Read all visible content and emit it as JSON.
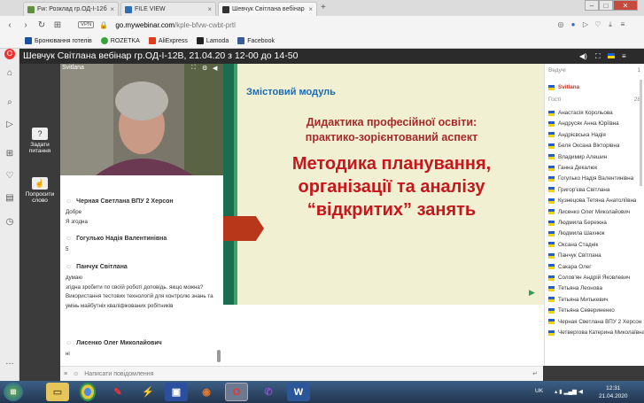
{
  "browser": {
    "tabs": [
      {
        "label": "Fw: Розклад гр.ОД-І-12б",
        "icon_color": "#5e8e3e"
      },
      {
        "label": "FILE VIEW",
        "icon_color": "#2e6db5"
      },
      {
        "label": "Шевчук Світлана вебінар",
        "icon_color": "#333333"
      }
    ],
    "new_tab": "+",
    "vpn": "VPN",
    "url_domain": "go.mywebinar.com",
    "url_path": "/kple-bfvw-cwbt-prtl",
    "bookmarks": [
      {
        "label": "Бронювання готелів",
        "color": "#1b4fa0"
      },
      {
        "label": "ROZETKA",
        "color": "#3aa33a"
      },
      {
        "label": "AliExpress",
        "color": "#e23c1e"
      },
      {
        "label": "Lamoda",
        "color": "#222222"
      },
      {
        "label": "Facebook",
        "color": "#3b5998"
      }
    ]
  },
  "webinar": {
    "title": "Шевчук Світлана вебінар гр.ОД-І-12В, 21.04.20 з 12-00 до 14-50",
    "left_buttons": [
      {
        "label": "Задати питання",
        "icon": "question-icon"
      },
      {
        "label": "Попросити слово",
        "icon": "raise-hand-icon"
      }
    ],
    "video": {
      "speaker": "Svitlana"
    },
    "chat": {
      "messages": [
        {
          "author": "Черная Светлана ВПУ 2 Херсон",
          "text": "Добре\nЯ згодна"
        },
        {
          "author": "Гогулько Надія Валентинівна",
          "text": "5"
        },
        {
          "author": "Панчук Світлана",
          "text": "думаю\nзгідна зробити по своїй роботі доповідь. якщо можна?\nВикористання тестових технологій для контролю знань та умінь майбутніх кваліфікованих робітників"
        },
        {
          "author": "Лисенко Олег Миколайович",
          "text": "ні"
        }
      ],
      "input_placeholder": "Написати повідомлення"
    },
    "slide": {
      "module": "Змістовий модуль",
      "subtitle": "Дидактика професійної освіти:\nпрактико-зорієнтований аспект",
      "main": "Методика планування,\nорганізації та аналізу\n“відкритих” занять"
    },
    "participants": {
      "presenters_label": "Ведучі",
      "presenters_count": "1",
      "presenter": "Svitlana",
      "guests_label": "Гості",
      "guests_count": "28",
      "guests": [
        "Анастасія Корольова",
        "Андрусяк Анна Юріївна",
        "Андрієвська Надія",
        "Беля Оксана Вікторівна",
        "Владимир Алешин",
        "Ганна Декалюк",
        "Гогулько Надія Валентинівна",
        "Григор'єва Світлана",
        "Кузнецова Тетяна Анатоліївна",
        "Лисенко Олег Миколайович",
        "Людмила Бережна",
        "Людмила Шахнюк",
        "Оксана Стаднік",
        "Панчук Світлана",
        "Сакара Олег",
        "Солов'ян Андрій Яковлевич",
        "Тетьяна Леонова",
        "Тетьяна Митькевич",
        "Тетьяна Севериненко",
        "Черная Светлана ВПУ 2 Херсон",
        "Четвергова Катерина Миколаївна"
      ]
    }
  },
  "taskbar": {
    "lang": "UK",
    "time": "12:31",
    "date": "21.04.2020"
  }
}
